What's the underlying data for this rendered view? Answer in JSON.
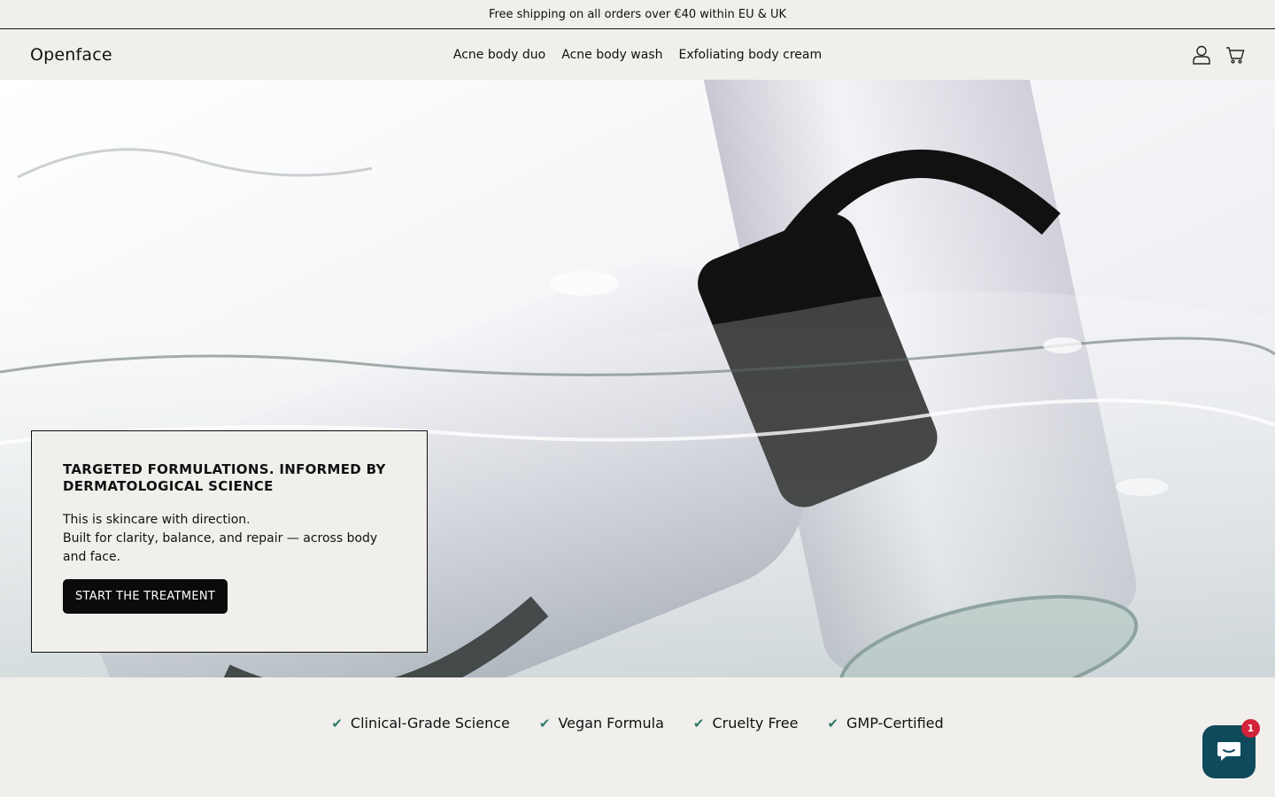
{
  "announcement": "Free shipping on all orders over €40 within EU & UK",
  "header": {
    "logo": "Openface",
    "nav": [
      "Acne body duo",
      "Acne body wash",
      "Exfoliating body cream"
    ],
    "icons": [
      "account-icon",
      "cart-icon"
    ]
  },
  "hero": {
    "card": {
      "title": "TARGETED FORMULATIONS. INFORMED BY DERMATOLOGICAL SCIENCE",
      "body_line1": "This is skincare with direction.",
      "body_line2": "Built for clarity, balance, and repair — across body and face.",
      "button": "START THE TREATMENT"
    }
  },
  "features": [
    "Clinical-Grade Science",
    "Vegan Formula",
    "Cruelty Free",
    "GMP-Certified"
  ],
  "chat": {
    "badge": "1",
    "icon": "chat-icon"
  },
  "colors": {
    "background": "#f0efec",
    "button": "#0b0b0b",
    "check": "#2f7a6a",
    "chat": "#0f4a5c",
    "badge": "#d3233a"
  }
}
